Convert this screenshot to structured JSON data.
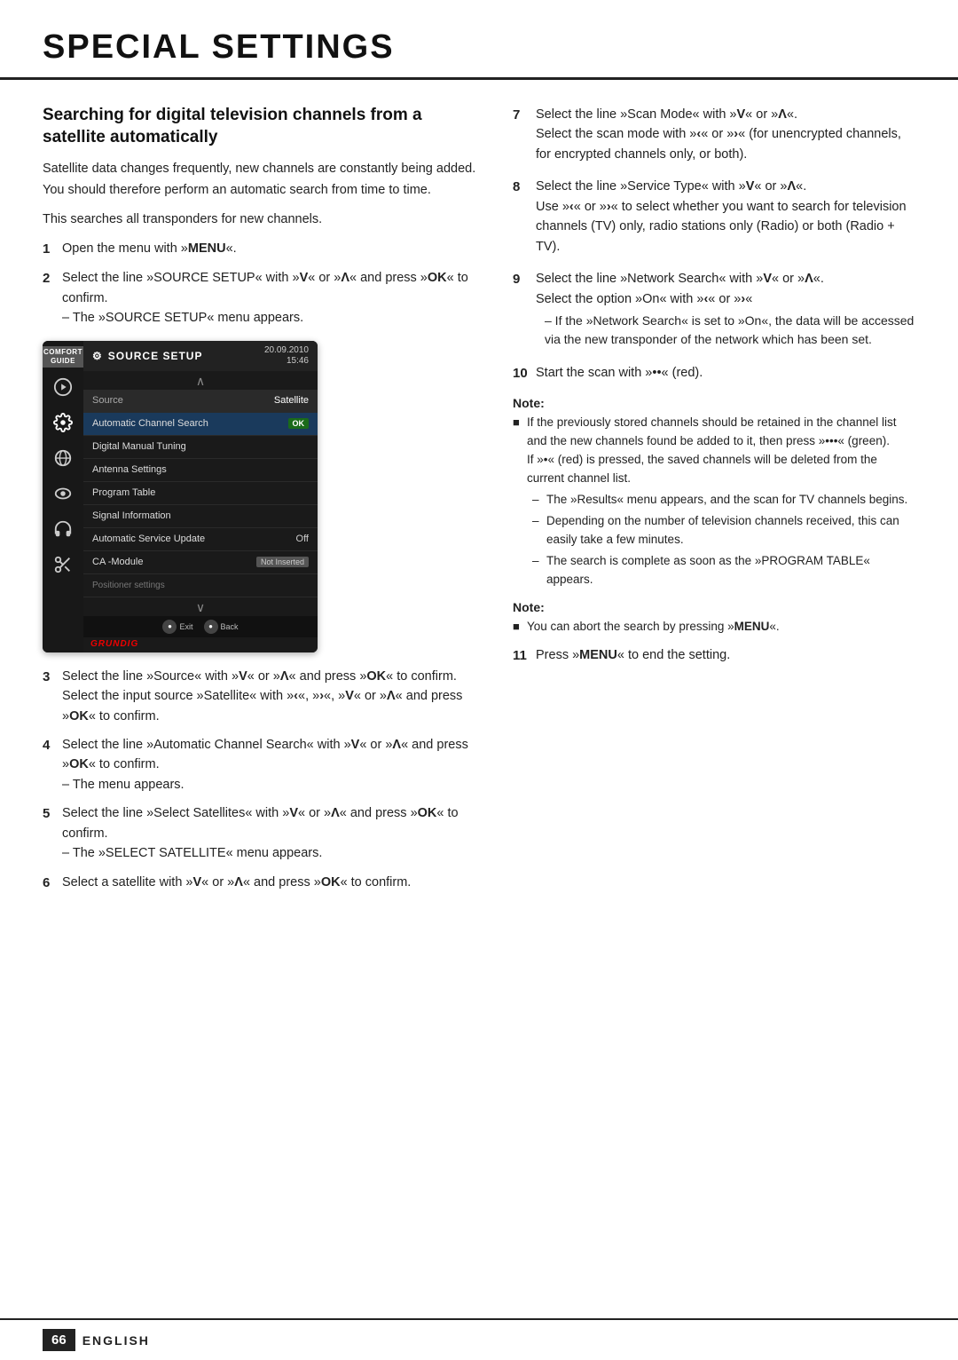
{
  "page": {
    "title": "SPECIAL SETTINGS",
    "footer": {
      "page_num": "66",
      "language": "ENGLISH"
    }
  },
  "left": {
    "section_heading": "Searching for digital television channels from a satellite automatically",
    "intro": [
      "Satellite data changes frequently, new channels are constantly being added. You should therefore perform an automatic search from time to time.",
      "This searches all transponders for new channels."
    ],
    "steps": [
      {
        "num": "1",
        "text": "Open the menu with »MENU«."
      },
      {
        "num": "2",
        "text": "Select the line »SOURCE SETUP« with »V« or »Λ« and press »OK« to confirm.\n– The »SOURCE SETUP« menu appears."
      },
      {
        "num": "3",
        "text": "Select the line »Source« with »V« or »Λ« and press »OK« to confirm.\nSelect the input source »Satellite« with »‹«, »›«, »V« or »Λ« and press »OK« to confirm."
      },
      {
        "num": "4",
        "text": "Select the line »Automatic Channel Search« with »V« or »Λ« and press »OK« to confirm.\n– The menu appears."
      },
      {
        "num": "5",
        "text": "Select the line »Select Satellites« with »V« or »Λ« and press »OK« to confirm.\n– The »SELECT SATELLITE« menu appears."
      },
      {
        "num": "6",
        "text": "Select a satellite with »V« or »Λ« and press »OK« to confirm."
      }
    ],
    "tv_screen": {
      "comfort_guide": "COMFORT\nGUIDE",
      "title": "SOURCE SETUP",
      "date": "20.09.2010",
      "time": "15:46",
      "source_label": "Source",
      "source_value": "Satellite",
      "menu_items": [
        {
          "label": "Automatic Channel Search",
          "value": "",
          "badge": "OK",
          "highlighted": true
        },
        {
          "label": "Digital Manual Tuning",
          "value": "",
          "badge": "",
          "highlighted": false
        },
        {
          "label": "Antenna Settings",
          "value": "",
          "badge": "",
          "highlighted": false
        },
        {
          "label": "Program Table",
          "value": "",
          "badge": "",
          "highlighted": false
        },
        {
          "label": "Signal Information",
          "value": "",
          "badge": "",
          "highlighted": false
        },
        {
          "label": "Automatic Service Update",
          "value": "Off",
          "badge": "",
          "highlighted": false
        },
        {
          "label": "CA -Module",
          "value": "Not Inserted",
          "badge": "",
          "highlighted": false
        },
        {
          "label": "Positioner settings",
          "value": "",
          "badge": "",
          "highlighted": false,
          "small": true
        }
      ],
      "bottom_buttons": [
        {
          "icon": "●",
          "label": "Exit"
        },
        {
          "icon": "●",
          "label": "Back"
        }
      ],
      "grundig": "GRUNDIG"
    },
    "note1": {
      "title": "Note:",
      "items": []
    }
  },
  "right": {
    "steps": [
      {
        "num": "7",
        "content": "Select the line »Scan Mode« with »V« or »Λ«.\nSelect the scan mode with »‹« or »›« (for unencrypted channels, for encrypted channels only, or both)."
      },
      {
        "num": "8",
        "content": "Select the line »Service Type« with »V« or »Λ«.\nUse »‹« or »›« to select whether you want to search for television channels (TV) only, radio stations only (Radio) or both (Radio + TV)."
      },
      {
        "num": "9",
        "content": "Select the line »Network Search« with »V« or »Λ«.\nSelect the option »On« with »‹« or »›«\n– If the »Network Search« is set to »On«, the data will be accessed via the new transponder of the network which has been set."
      },
      {
        "num": "10",
        "content": "Start the scan with »••« (red)."
      }
    ],
    "note1": {
      "title": "Note:",
      "items": [
        {
          "text": "If the previously stored channels should be retained in the channel list and the new channels found be added to it, then press »•••« (green).\nIf »•« (red) is pressed, the saved channels will be deleted from the current channel list.",
          "sub_bullets": [
            "The »Results« menu appears, and the scan for TV channels begins.",
            "Depending on the number of television channels received, this can easily take a few minutes.",
            "The search is complete as soon as the »PROGRAM TABLE« appears."
          ]
        }
      ]
    },
    "note2": {
      "title": "Note:",
      "items": [
        {
          "text": "You can abort the search by pressing »MENU«."
        }
      ]
    },
    "step11": {
      "num": "11",
      "content": "Press »MENU« to end the setting."
    }
  }
}
